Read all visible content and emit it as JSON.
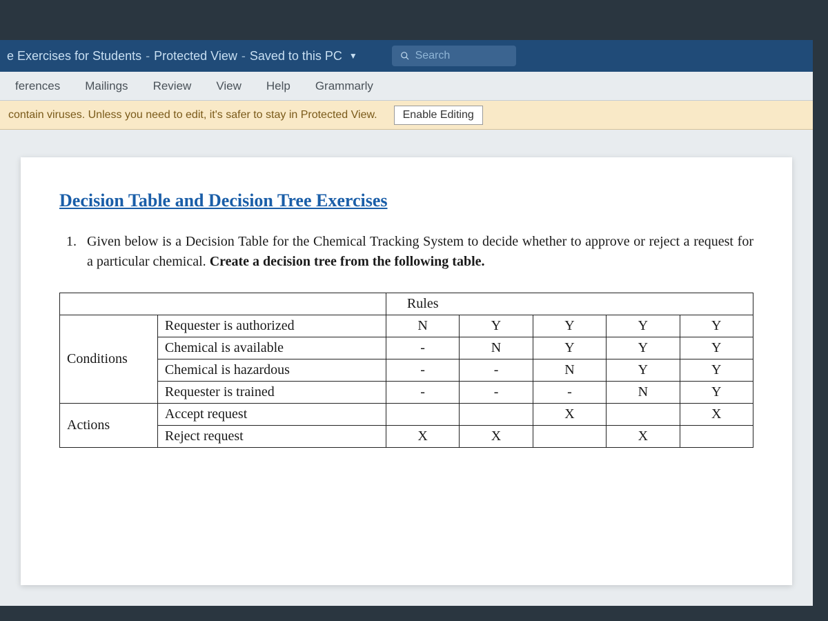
{
  "title": {
    "doc_name": "e Exercises for Students",
    "protected_view": "Protected View",
    "saved": "Saved to this PC",
    "separator": "-"
  },
  "search": {
    "placeholder": "Search"
  },
  "ribbon": {
    "tabs": [
      "ferences",
      "Mailings",
      "Review",
      "View",
      "Help",
      "Grammarly"
    ]
  },
  "protected_bar": {
    "message": " contain viruses. Unless you need to edit, it's safer to stay in Protected View.",
    "button": "Enable Editing"
  },
  "document": {
    "heading": "Decision Table and Decision Tree Exercises",
    "question_number": "1.",
    "question_text_1": "Given below is a Decision Table for the Chemical Tracking System to decide whether to approve or reject a request for a particular chemical. ",
    "question_text_bold": "Create a decision tree from the    following table.",
    "table": {
      "rules_label": "Rules",
      "groups": [
        "Conditions",
        "Actions"
      ],
      "conditions": [
        {
          "label": "Requester is authorized",
          "cells": [
            "N",
            "Y",
            "Y",
            "Y",
            "Y"
          ]
        },
        {
          "label": "Chemical is available",
          "cells": [
            "-",
            "N",
            "Y",
            "Y",
            "Y"
          ]
        },
        {
          "label": "Chemical is hazardous",
          "cells": [
            "-",
            "-",
            "N",
            "Y",
            "Y"
          ]
        },
        {
          "label": "Requester is trained",
          "cells": [
            "-",
            "-",
            "-",
            "N",
            "Y"
          ]
        }
      ],
      "actions": [
        {
          "label": "Accept request",
          "cells": [
            "",
            "",
            "X",
            "",
            "X"
          ]
        },
        {
          "label": "Reject request",
          "cells": [
            "X",
            "X",
            "",
            "X",
            ""
          ]
        }
      ]
    }
  }
}
